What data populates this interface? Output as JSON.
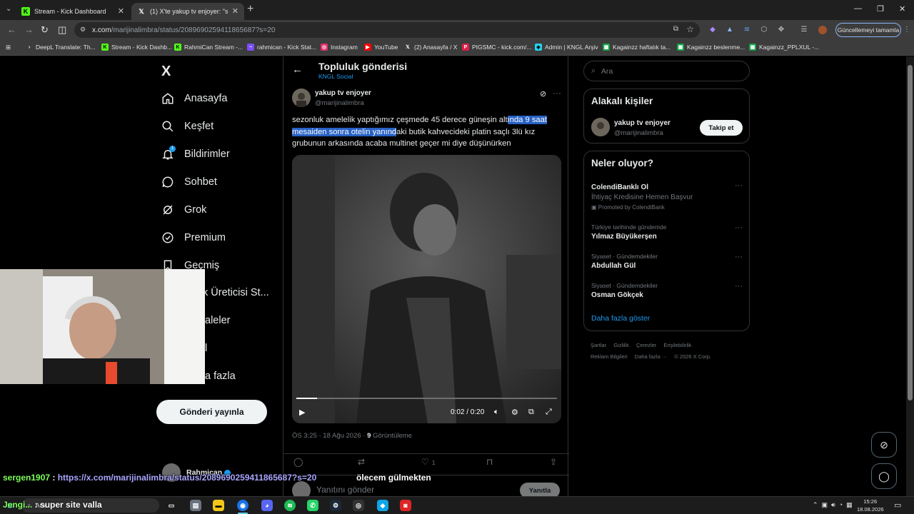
{
  "browser": {
    "tabs": [
      {
        "title": "Stream - Kick Dashboard",
        "active": false
      },
      {
        "title": "(1) X'te yakup tv enjoyer: \"s",
        "active": true
      }
    ],
    "url_domain": "x.com",
    "url_path": "/marijinalimbra/status/2089690259411865687?s=20",
    "update_label": "Güncellemeyi tamamla",
    "bookmarks": [
      "DeepL Translate: Th...",
      "Stream - Kick Dashb...",
      "RahmiCan Stream -...",
      "rahmican - Kick Stat...",
      "Instagram",
      "YouTube",
      "(2) Anasayfa / X",
      "PIGSMC - kick.com/...",
      "Admin | KNGL Arşiv",
      "Kagainzz haftalık ta...",
      "Kagainzz beslenme...",
      "Kagainzz_PPLXUL -..."
    ]
  },
  "sidebar": {
    "logo": "X",
    "items": [
      {
        "label": "Anasayfa"
      },
      {
        "label": "Keşfet"
      },
      {
        "label": "Bildirimler",
        "badge": "1"
      },
      {
        "label": "Sohbet"
      },
      {
        "label": "Grok"
      },
      {
        "label": "Premium"
      },
      {
        "label": "Geçmiş"
      },
      {
        "label": "k Üreticisi St..."
      },
      {
        "label": "aleler"
      },
      {
        "label": "l"
      },
      {
        "label": "a fazla"
      }
    ],
    "post_button": "Gönderi yayınla",
    "account_name": "Rahmican"
  },
  "post": {
    "header_title": "Topluluk gönderisi",
    "community": "KNGL Social",
    "author_name": "yakup tv enjoyer",
    "author_handle": "@marijinalimbra",
    "text_before": "sezonluk amelelik yaptığımız çeşmede 45 derece güneşin alt",
    "text_highlight": "ında 9 saat mesaiden sonra otelin yanınd",
    "text_after": "aki butik kahvecideki platin saçlı 3lü kız grubunun arkasında acaba multinet geçer mi diye düşünürken",
    "video_time": "0:02 / 0:20",
    "video_progress": 0.08,
    "meta_time": "ÖS 3:25 · 18 Ağu 2026 · ",
    "meta_views_count": "9",
    "meta_views_label": " Görüntüleme",
    "like_count": "1",
    "reply_placeholder": "Yanıtını gönder",
    "reply_button": "Yanıtla"
  },
  "right": {
    "search_placeholder": "Ara",
    "related_title": "Alakalı kişiler",
    "related_name": "yakup tv enjoyer",
    "related_handle": "@marijinalimbra",
    "follow_label": "Takip et",
    "trends_title": "Neler oluyor?",
    "trends": [
      {
        "context": "",
        "title": "ColendiBanklı Ol",
        "subtitle": "İhtiyaç Kredisine Hemen Başvur",
        "promo": "Promoted by ColendiBank"
      },
      {
        "context": "Türkiye tarihinde gündemde",
        "title": "Yılmaz Büyükerşen"
      },
      {
        "context": "Siyaset · Gündemdekiler",
        "title": "Abdullah Gül"
      },
      {
        "context": "Siyaset · Gündemdekiler",
        "title": "Osman Gökçek"
      }
    ],
    "show_more": "Daha fazla göster",
    "footer_links": [
      "Şartlar",
      "Gizlilik",
      "Çerezler",
      "Erişilebilirlik",
      "Reklam Bilgileri",
      "Daha fazla ···",
      "© 2026 X Corp."
    ]
  },
  "chat": {
    "user1": "sergen1907",
    "separator": " : ",
    "link": "https://x.com/marijinalimbra/status/2089690259411865687?s=20",
    "msg1": " ölecem gülmekten",
    "user2": "Jengi...",
    "msg2": " super site valla"
  },
  "taskbar": {
    "search_label": "Ara",
    "clock_time": "15:26",
    "clock_date": "18.08.2026"
  }
}
